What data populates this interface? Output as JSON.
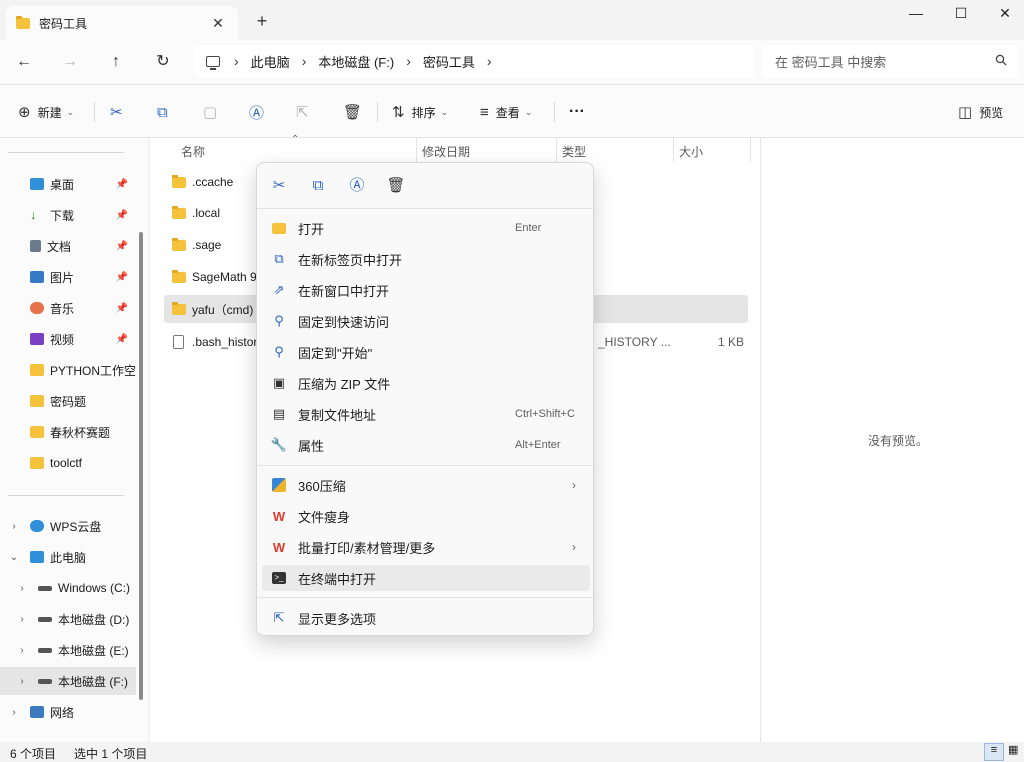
{
  "window": {
    "tab_title": "密码工具",
    "new_tab": "+",
    "minimize": "—",
    "maximize": "☐",
    "close": "✕"
  },
  "address": {
    "breadcrumb": [
      "此电脑",
      "本地磁盘 (F:)",
      "密码工具"
    ],
    "search_placeholder": "在 密码工具 中搜索"
  },
  "toolbar": {
    "new_label": "新建",
    "sort_label": "排序",
    "view_label": "查看",
    "more_label": "···",
    "preview_label": "预览"
  },
  "sidebar": {
    "quick": [
      "桌面",
      "下载",
      "文档",
      "图片",
      "音乐",
      "视频",
      "PYTHON工作空",
      "密码题",
      "春秋杯赛题",
      "toolctf"
    ],
    "tree": [
      "WPS云盘",
      "此电脑",
      "Windows (C:)",
      "本地磁盘 (D:)",
      "本地磁盘 (E:)",
      "本地磁盘 (F:)",
      "网络"
    ]
  },
  "columns": {
    "name": "名称",
    "date": "修改日期",
    "type": "类型",
    "size": "大小"
  },
  "files": [
    {
      "name": ".ccache",
      "type": "",
      "size": ""
    },
    {
      "name": ".local",
      "type": "",
      "size": ""
    },
    {
      "name": ".sage",
      "type": "",
      "size": ""
    },
    {
      "name": "SageMath 9",
      "type": "",
      "size": ""
    },
    {
      "name": "yafu（cmd)",
      "type": "",
      "size": ""
    },
    {
      "name": ".bash_histor",
      "type": "_HISTORY ...",
      "size": "1 KB"
    }
  ],
  "preview": {
    "empty_text": "没有预览。"
  },
  "status": {
    "count": "6 个项目",
    "selected": "选中 1 个项目"
  },
  "context_menu": {
    "open": "打开",
    "open_shortcut": "Enter",
    "open_new_tab": "在新标签页中打开",
    "open_new_window": "在新窗口中打开",
    "pin_quick": "固定到快速访问",
    "pin_start": "固定到\"开始\"",
    "zip": "压缩为 ZIP 文件",
    "copy_path": "复制文件地址",
    "copy_path_shortcut": "Ctrl+Shift+C",
    "properties": "属性",
    "properties_shortcut": "Alt+Enter",
    "zip360": "360压缩",
    "slim": "文件瘦身",
    "wps_batch": "批量打印/素材管理/更多",
    "terminal": "在终端中打开",
    "more_options": "显示更多选项"
  }
}
